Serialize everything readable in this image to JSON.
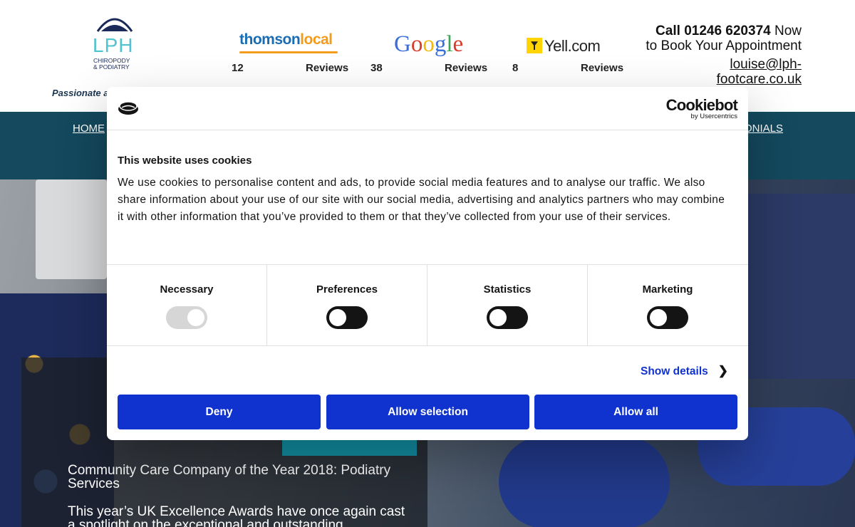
{
  "header": {
    "logo": {
      "text": "LPH",
      "subtitle_line1": "CHIROPODY",
      "subtitle_line2": "& PODIATRY"
    },
    "tagline": "Passionate a",
    "reviews": [
      {
        "source": "thomsonlocal",
        "source_part1": "thomson",
        "source_part2": "local",
        "count": "12",
        "label": "Reviews"
      },
      {
        "source": "Google",
        "count": "38",
        "label": "Reviews"
      },
      {
        "source": "Yell.com",
        "count": "8",
        "label": "Reviews"
      }
    ],
    "contact": {
      "call_prefix": "Call",
      "phone": "01246 620374",
      "call_suffix": "Now",
      "line2": "to Book Your Appointment",
      "email_line1": "louise@lph-",
      "email_line2": "footcare.co.uk"
    }
  },
  "nav": {
    "home": "HOME",
    "testimonials_partial": "ONIALS"
  },
  "hero": {
    "news_title": "Community Care Company of the Year 2018: Podiatry Services",
    "news_text": "This year’s UK Excellence Awards have once again cast a spotlight on the exceptional and outstanding"
  },
  "cookie_dialog": {
    "brand": "Cookiebot",
    "brand_by": "by Usercentrics",
    "title": "This website uses cookies",
    "text": "We use cookies to personalise content and ads, to provide social media features and to analyse our traffic. We also share information about your use of our site with our social media, advertising and analytics partners who may combine it with other information that you’ve provided to them or that they’ve collected from your use of their services.",
    "categories": [
      {
        "label": "Necessary",
        "enabled": true,
        "disabled": true
      },
      {
        "label": "Preferences",
        "enabled": false,
        "disabled": false
      },
      {
        "label": "Statistics",
        "enabled": false,
        "disabled": false
      },
      {
        "label": "Marketing",
        "enabled": false,
        "disabled": false
      }
    ],
    "show_details": "Show details",
    "buttons": {
      "deny": "Deny",
      "allow_selection": "Allow selection",
      "allow_all": "Allow all"
    },
    "colors": {
      "primary": "#1032cf",
      "toggle_off": "#141414",
      "toggle_disabled": "#d6d6d6"
    }
  }
}
